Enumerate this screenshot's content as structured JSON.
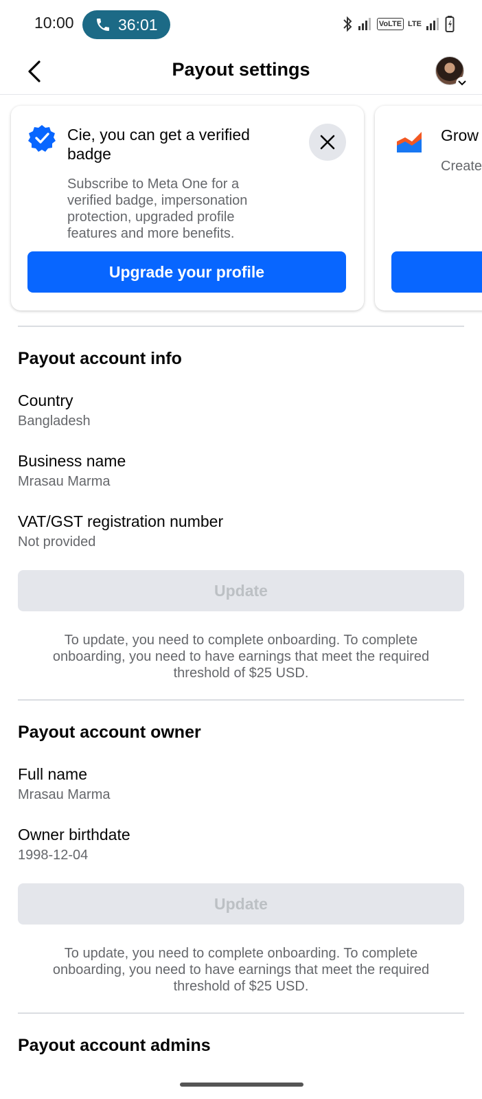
{
  "status_bar": {
    "time": "10:00",
    "call_timer": "36:01",
    "icons": [
      "bluetooth-icon",
      "signal-icon",
      "volte-icon",
      "lte-icon",
      "battery-icon"
    ],
    "volte_label": "VoLTE",
    "lte_label": "LTE"
  },
  "header": {
    "title": "Payout settings",
    "back_icon": "chevron-left-icon"
  },
  "promo_cards": [
    {
      "icon": "verified-badge-icon",
      "title": "Cie, you can get a verified badge",
      "description": "Subscribe to Meta One for a verified badge, impersonation protection, upgraded profile features and more benefits.",
      "button_label": "Upgrade your profile"
    },
    {
      "icon": "growth-chart-icon",
      "title": "Grow",
      "description": "Create and bu"
    }
  ],
  "sections": {
    "account_info": {
      "title": "Payout account info",
      "fields": [
        {
          "label": "Country",
          "value": "Bangladesh"
        },
        {
          "label": "Business name",
          "value": "Mrasau Marma"
        },
        {
          "label": "VAT/GST registration number",
          "value": "Not provided"
        }
      ],
      "update_label": "Update",
      "helper": "To update, you need to complete onboarding. To complete onboarding, you need to have earnings that meet the required threshold of $25 USD."
    },
    "account_owner": {
      "title": "Payout account owner",
      "fields": [
        {
          "label": "Full name",
          "value": "Mrasau Marma"
        },
        {
          "label": "Owner birthdate",
          "value": "1998-12-04"
        }
      ],
      "update_label": "Update",
      "helper": "To update, you need to complete onboarding. To complete onboarding, you need to have earnings that meet the required threshold of $25 USD."
    },
    "account_admins": {
      "title": "Payout account admins"
    }
  },
  "colors": {
    "primary": "#0866ff",
    "call_pill": "#1c6a86",
    "secondary_text": "#65676b",
    "disabled_bg": "#e4e6eb"
  }
}
